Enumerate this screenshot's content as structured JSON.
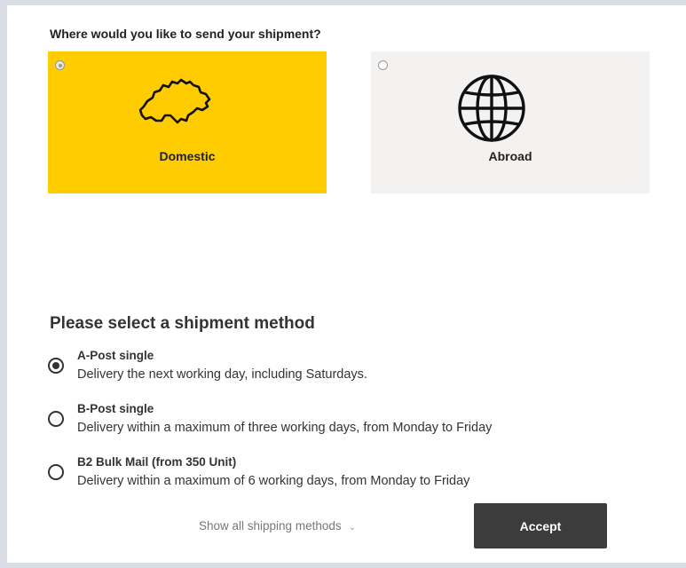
{
  "destination": {
    "question": "Where would you like to send your shipment?",
    "options": [
      {
        "label": "Domestic",
        "icon": "switzerland-map-icon",
        "selected": true,
        "color": "#ffcc00"
      },
      {
        "label": "Abroad",
        "icon": "globe-icon",
        "selected": false,
        "color": "#f3f2f0"
      }
    ]
  },
  "method": {
    "heading": "Please select a shipment method",
    "options": [
      {
        "name": "A-Post single",
        "description": "Delivery the next working day, including Saturdays.",
        "selected": true
      },
      {
        "name": "B-Post single",
        "description": "Delivery within a maximum of three working days, from Monday to Friday",
        "selected": false
      },
      {
        "name": "B2 Bulk Mail (from 350 Unit)",
        "description": "Delivery within a maximum of 6 working days, from Monday to Friday",
        "selected": false
      }
    ]
  },
  "footer": {
    "show_all_label": "Show all shipping methods",
    "accept_label": "Accept",
    "accept_color": "#3c3c3c"
  }
}
